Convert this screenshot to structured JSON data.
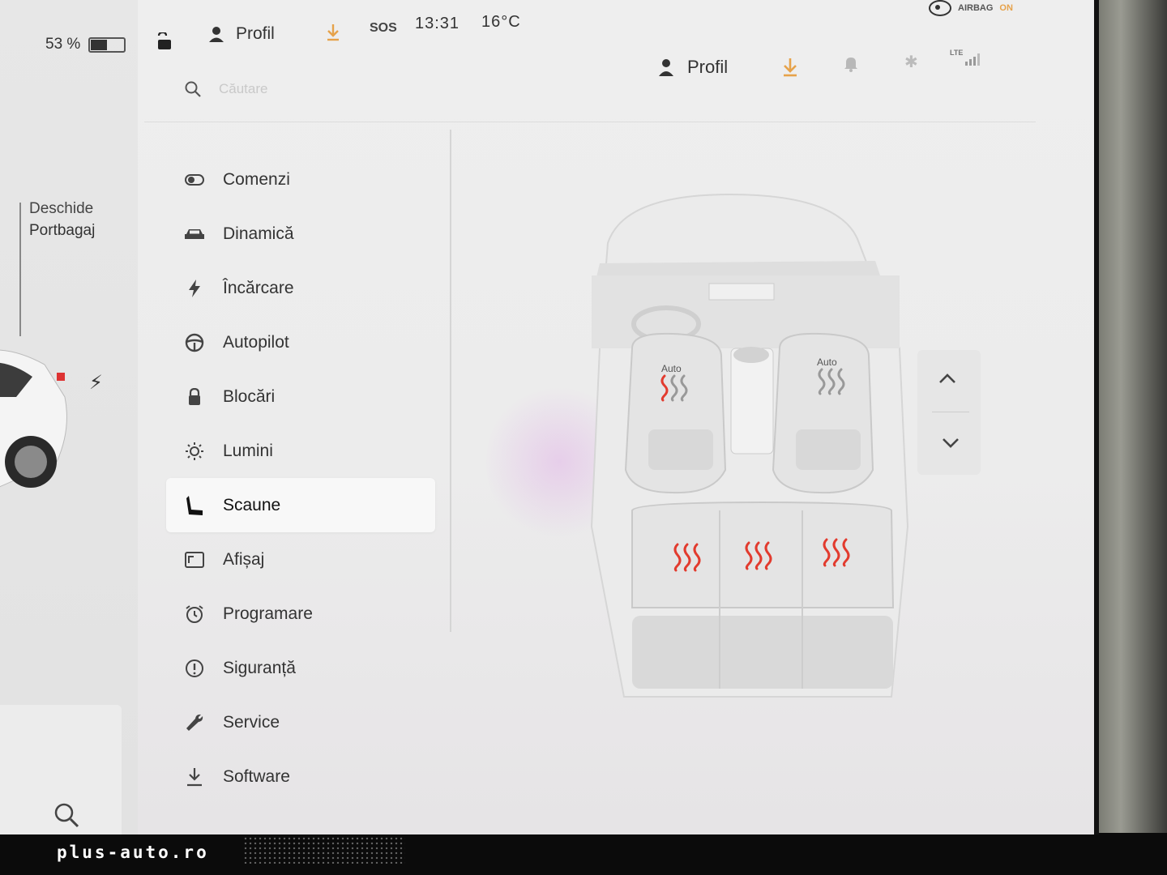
{
  "status_bar": {
    "battery_percent": "53 %",
    "battery_level": 0.53,
    "profile_label": "Profil",
    "sos_label": "SOS",
    "time": "13:31",
    "temperature": "16°C",
    "airbag_label": "AIRBAG",
    "airbag_state": "ON"
  },
  "left_panel": {
    "trunk_line1": "Deschide",
    "trunk_line2": "Portbagaj"
  },
  "header": {
    "search_placeholder": "Căutare",
    "profile_label": "Profil",
    "lte_label": "LTE"
  },
  "menu": {
    "items": [
      {
        "label": "Comenzi",
        "icon": "toggle-icon"
      },
      {
        "label": "Dinamică",
        "icon": "car-icon"
      },
      {
        "label": "Încărcare",
        "icon": "bolt-icon"
      },
      {
        "label": "Autopilot",
        "icon": "steering-wheel-icon"
      },
      {
        "label": "Blocări",
        "icon": "lock-icon"
      },
      {
        "label": "Lumini",
        "icon": "sun-icon"
      },
      {
        "label": "Scaune",
        "icon": "seat-icon"
      },
      {
        "label": "Afișaj",
        "icon": "display-icon"
      },
      {
        "label": "Programare",
        "icon": "alarm-clock-icon"
      },
      {
        "label": "Siguranță",
        "icon": "info-circle-icon"
      },
      {
        "label": "Service",
        "icon": "wrench-icon"
      },
      {
        "label": "Software",
        "icon": "download-icon"
      }
    ],
    "active_index": 6
  },
  "seats": {
    "front_left_label": "Auto",
    "front_right_label": "Auto",
    "active_heat_color": "#e23b2e",
    "inactive_heat_color": "#999999"
  },
  "colors": {
    "accent_download": "#e6a24a"
  },
  "watermark": "plus-auto.ro"
}
